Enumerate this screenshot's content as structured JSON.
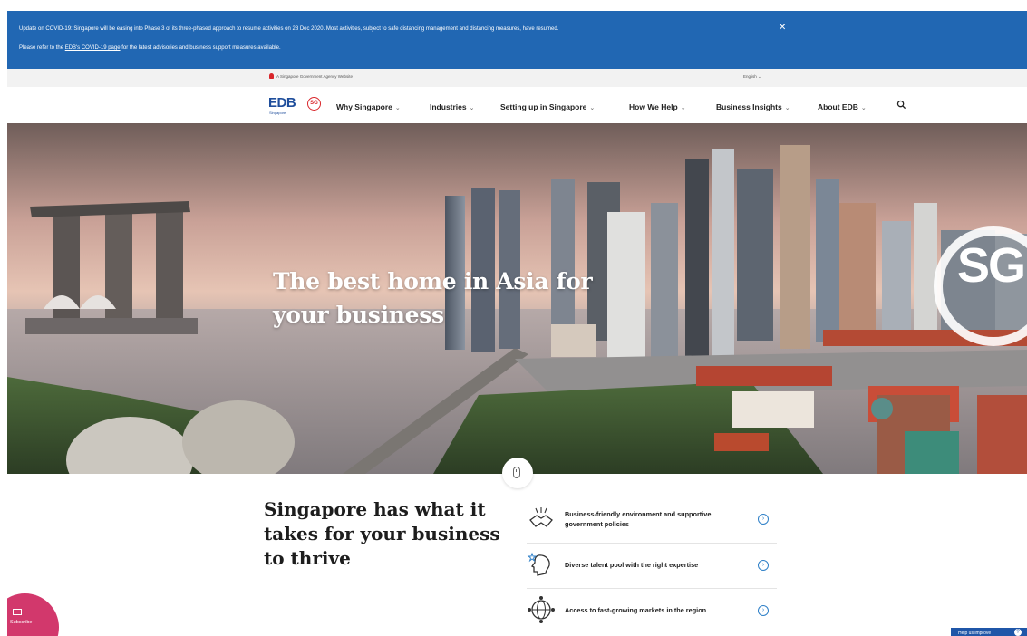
{
  "covid_banner": {
    "line1": "Update on COVID-19: Singapore will be easing into Phase 3 of its three-phased approach to resume activities on 28 Dec 2020. Most activities, subject to safe distancing management and distancing measures, have resumed.",
    "line2_prefix": "Please refer to the",
    "line2_link": "EDB's COVID-19 page",
    "line2_suffix": "for the latest advisories and business support measures available.",
    "close_glyph": "✕"
  },
  "gov_bar": {
    "agency_text": "A Singapore Government Agency Website",
    "language": "English",
    "language_chevron": "⌄"
  },
  "header": {
    "logo_text": "EDB",
    "logo_subtext": "Singapore",
    "sg_badge": "SG",
    "menu": [
      {
        "label": "Why Singapore"
      },
      {
        "label": "Industries"
      },
      {
        "label": "Setting up in Singapore"
      },
      {
        "label": "How We Help"
      },
      {
        "label": "Business Insights"
      },
      {
        "label": "About EDB"
      }
    ],
    "chevron": "⌄",
    "search_icon": "search-icon"
  },
  "hero": {
    "headline": "The best home in Asia for your business",
    "watermark": "SG"
  },
  "section": {
    "lead": "Singapore has what it takes for your business to thrive",
    "features": [
      {
        "label": "Business-friendly environment and supportive government policies",
        "icon": "handshake-icon"
      },
      {
        "label": "Diverse talent pool with the right expertise",
        "icon": "talent-head-icon"
      },
      {
        "label": "Access to fast-growing markets in the region",
        "icon": "network-globe-icon"
      }
    ],
    "arrow_glyph": "›"
  },
  "subscribe": {
    "label": "Subscribe",
    "icon": "mail-icon"
  },
  "help_button": {
    "label": "Help us improve",
    "glyph": "?"
  },
  "colors": {
    "banner_blue": "#2167b3",
    "brand_blue": "#1f4e9c",
    "sg_red": "#d9262b",
    "subscribe_pink": "#d2386c",
    "link_blue": "#2f80c8"
  }
}
